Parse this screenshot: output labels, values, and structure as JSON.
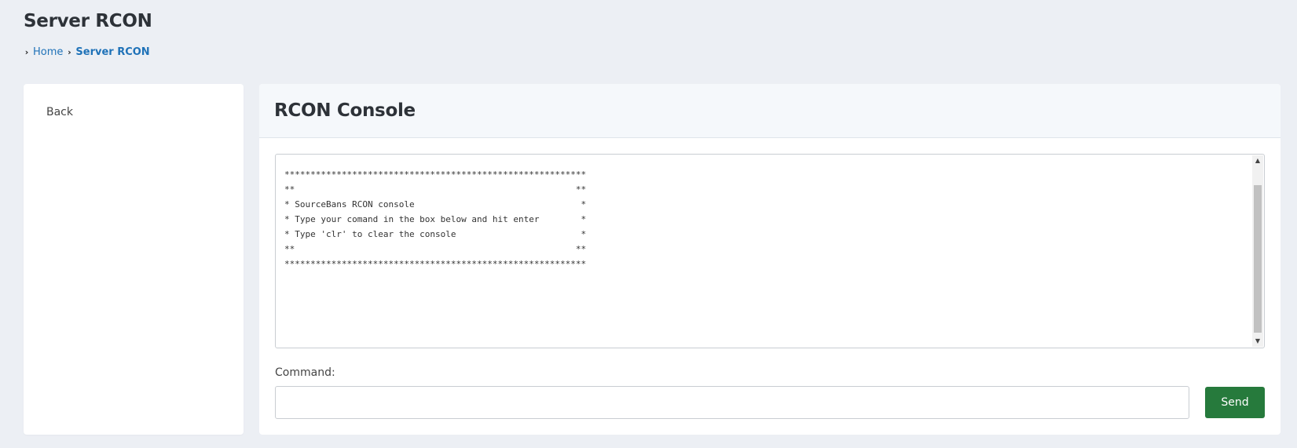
{
  "page": {
    "title": "Server RCON"
  },
  "breadcrumb": {
    "separator": "›",
    "items": [
      {
        "label": "Home"
      },
      {
        "label": "Server RCON"
      }
    ]
  },
  "sidebar": {
    "items": [
      {
        "label": "Back"
      }
    ]
  },
  "console": {
    "title": "RCON Console",
    "output": "**********************************************************\n**                                                      **\n* SourceBans RCON console                                *\n* Type your comand in the box below and hit enter        *\n* Type 'clr' to clear the console                        *\n**                                                      **\n**********************************************************"
  },
  "command": {
    "label": "Command:",
    "value": "",
    "send_label": "Send"
  },
  "icons": {
    "breadcrumb_separator": "chevron-right-icon",
    "scroll_up": "triangle-up-icon",
    "scroll_down": "triangle-down-icon"
  },
  "colors": {
    "background": "#eceff4",
    "link": "#1f72b8",
    "send_button": "#267a3c",
    "card_header": "#f5f8fb"
  }
}
